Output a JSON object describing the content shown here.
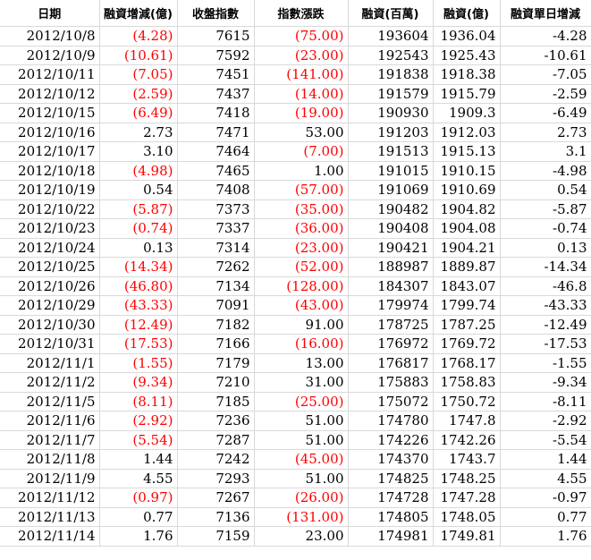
{
  "headers": [
    "日期",
    "融資增減(億)",
    "收盤指數",
    "指數漲跌",
    "融資(百萬)",
    "融資(億)",
    "融資單日增減"
  ],
  "rows": [
    [
      "2012/10/8",
      "(4.28)",
      "7615",
      "(75.00)",
      "193604",
      "1936.04",
      "-4.28"
    ],
    [
      "2012/10/9",
      "(10.61)",
      "7592",
      "(23.00)",
      "192543",
      "1925.43",
      "-10.61"
    ],
    [
      "2012/10/11",
      "(7.05)",
      "7451",
      "(141.00)",
      "191838",
      "1918.38",
      "-7.05"
    ],
    [
      "2012/10/12",
      "(2.59)",
      "7437",
      "(14.00)",
      "191579",
      "1915.79",
      "-2.59"
    ],
    [
      "2012/10/15",
      "(6.49)",
      "7418",
      "(19.00)",
      "190930",
      "1909.3",
      "-6.49"
    ],
    [
      "2012/10/16",
      "2.73",
      "7471",
      "53.00",
      "191203",
      "1912.03",
      "2.73"
    ],
    [
      "2012/10/17",
      "3.10",
      "7464",
      "(7.00)",
      "191513",
      "1915.13",
      "3.1"
    ],
    [
      "2012/10/18",
      "(4.98)",
      "7465",
      "1.00",
      "191015",
      "1910.15",
      "-4.98"
    ],
    [
      "2012/10/19",
      "0.54",
      "7408",
      "(57.00)",
      "191069",
      "1910.69",
      "0.54"
    ],
    [
      "2012/10/22",
      "(5.87)",
      "7373",
      "(35.00)",
      "190482",
      "1904.82",
      "-5.87"
    ],
    [
      "2012/10/23",
      "(0.74)",
      "7337",
      "(36.00)",
      "190408",
      "1904.08",
      "-0.74"
    ],
    [
      "2012/10/24",
      "0.13",
      "7314",
      "(23.00)",
      "190421",
      "1904.21",
      "0.13"
    ],
    [
      "2012/10/25",
      "(14.34)",
      "7262",
      "(52.00)",
      "188987",
      "1889.87",
      "-14.34"
    ],
    [
      "2012/10/26",
      "(46.80)",
      "7134",
      "(128.00)",
      "184307",
      "1843.07",
      "-46.8"
    ],
    [
      "2012/10/29",
      "(43.33)",
      "7091",
      "(43.00)",
      "179974",
      "1799.74",
      "-43.33"
    ],
    [
      "2012/10/30",
      "(12.49)",
      "7182",
      "91.00",
      "178725",
      "1787.25",
      "-12.49"
    ],
    [
      "2012/10/31",
      "(17.53)",
      "7166",
      "(16.00)",
      "176972",
      "1769.72",
      "-17.53"
    ],
    [
      "2012/11/1",
      "(1.55)",
      "7179",
      "13.00",
      "176817",
      "1768.17",
      "-1.55"
    ],
    [
      "2012/11/2",
      "(9.34)",
      "7210",
      "31.00",
      "175883",
      "1758.83",
      "-9.34"
    ],
    [
      "2012/11/5",
      "(8.11)",
      "7185",
      "(25.00)",
      "175072",
      "1750.72",
      "-8.11"
    ],
    [
      "2012/11/6",
      "(2.92)",
      "7236",
      "51.00",
      "174780",
      "1747.8",
      "-2.92"
    ],
    [
      "2012/11/7",
      "(5.54)",
      "7287",
      "51.00",
      "174226",
      "1742.26",
      "-5.54"
    ],
    [
      "2012/11/8",
      "1.44",
      "7242",
      "(45.00)",
      "174370",
      "1743.7",
      "1.44"
    ],
    [
      "2012/11/9",
      "4.55",
      "7293",
      "51.00",
      "174825",
      "1748.25",
      "4.55"
    ],
    [
      "2012/11/12",
      "(0.97)",
      "7267",
      "(26.00)",
      "174728",
      "1747.28",
      "-0.97"
    ],
    [
      "2012/11/13",
      "0.77",
      "7136",
      "(131.00)",
      "174805",
      "1748.05",
      "0.77"
    ],
    [
      "2012/11/14",
      "1.76",
      "7159",
      "23.00",
      "174981",
      "1749.81",
      "1.76"
    ]
  ],
  "colors": {
    "negative": "#ff0000",
    "grid": "#d9d9d9"
  }
}
